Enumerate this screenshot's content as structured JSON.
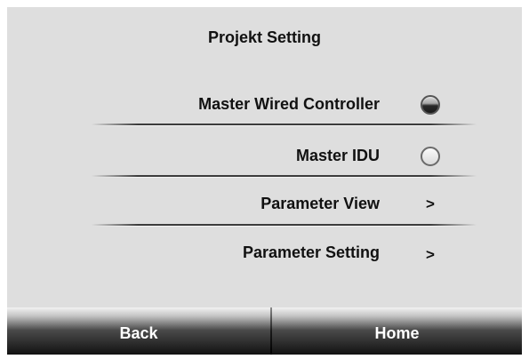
{
  "header": {
    "title": "Projekt Setting"
  },
  "menu": {
    "items": [
      {
        "label": "Master Wired Controller",
        "control": "radio",
        "selected": true
      },
      {
        "label": "Master IDU",
        "control": "radio",
        "selected": false
      },
      {
        "label": "Parameter View",
        "control": "chevron",
        "glyph": ">"
      },
      {
        "label": "Parameter Setting",
        "control": "chevron",
        "glyph": ">"
      }
    ]
  },
  "footer": {
    "back_label": "Back",
    "home_label": "Home"
  },
  "colors": {
    "background": "#dedede",
    "text": "#111111",
    "button_text": "#ffffff"
  }
}
